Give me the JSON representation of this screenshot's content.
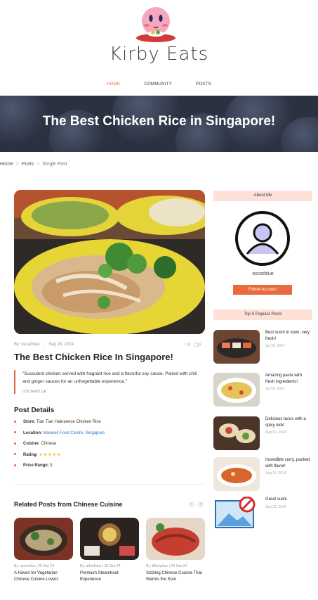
{
  "site": {
    "brand": "Kirby Eats"
  },
  "nav": {
    "items": [
      "HOME",
      "COMMUNITY",
      "POSTS"
    ],
    "active_color": "#e8643d"
  },
  "hero": {
    "title": "The Best Chicken Rice in Singapore!"
  },
  "breadcrumb": {
    "home": "Home",
    "posts": "Posts",
    "current": "Single Post",
    "sep": ">"
  },
  "post": {
    "author": "By: oscarblue",
    "date": "Sep 28, 2024",
    "likes": "0",
    "comments": "0",
    "title": "The Best Chicken Rice In Singapore!",
    "quote": "\"Succulent chicken served with fragrant rice and a flavorful soy sauce. Paired with chili and ginger sauces for an unforgettable experience.\"",
    "quote_author": "OSCARBLUE",
    "details_heading": "Post Details",
    "details": {
      "store_label": "Store:",
      "store_value": "Tian Tian Hainanese Chicken Rice",
      "location_label": "Location:",
      "location_value": "Maxwell Food Centre, Singapore",
      "cuisine_label": "Cuisine:",
      "cuisine_value": "Chinese",
      "rating_label": "Rating:",
      "rating_stars": 5,
      "rating_glyphs": "★★★★★",
      "price_label": "Price Range:",
      "price_value": "$"
    }
  },
  "related": {
    "heading": "Related Posts from Chinese Cuisine",
    "prev": "‹",
    "next": "›",
    "items": [
      {
        "meta": "By: oscarblue  |  28 Sep 24",
        "title": "A Haven for Vegetarian Chinese Cuisine Lovers"
      },
      {
        "meta": "By: alfredblue  |  28 Sep 24",
        "title": "Premium Steamboat Experience"
      },
      {
        "meta": "By: tiffanyblue  |  28 Sep 24",
        "title": "Sizzling Chinese Cuisine That Warms the Soul"
      }
    ]
  },
  "sidebar": {
    "about_heading": "About Me",
    "username": "oscarblue",
    "follow_label": "Follow Account",
    "popular_heading": "Top 5 Popular Posts",
    "popular": [
      {
        "title": "Best sushi in town, very fresh!",
        "date": "Jul 16, 2024"
      },
      {
        "title": "Amazing pasta with fresh ingredients!",
        "date": "Jul 09, 2024"
      },
      {
        "title": "Delicious tacos with a spicy kick!",
        "date": "Aug 09, 2024"
      },
      {
        "title": "Incredible curry, packed with flavor!",
        "date": "Aug 15, 2024"
      },
      {
        "title": "Great sushi",
        "date": "Sep 21, 2024"
      }
    ]
  },
  "colors": {
    "accent": "#e8643d",
    "soft_accent": "#fde0d8",
    "link": "#2a78d0",
    "star": "#f4b400",
    "price": "#2fae6f"
  }
}
